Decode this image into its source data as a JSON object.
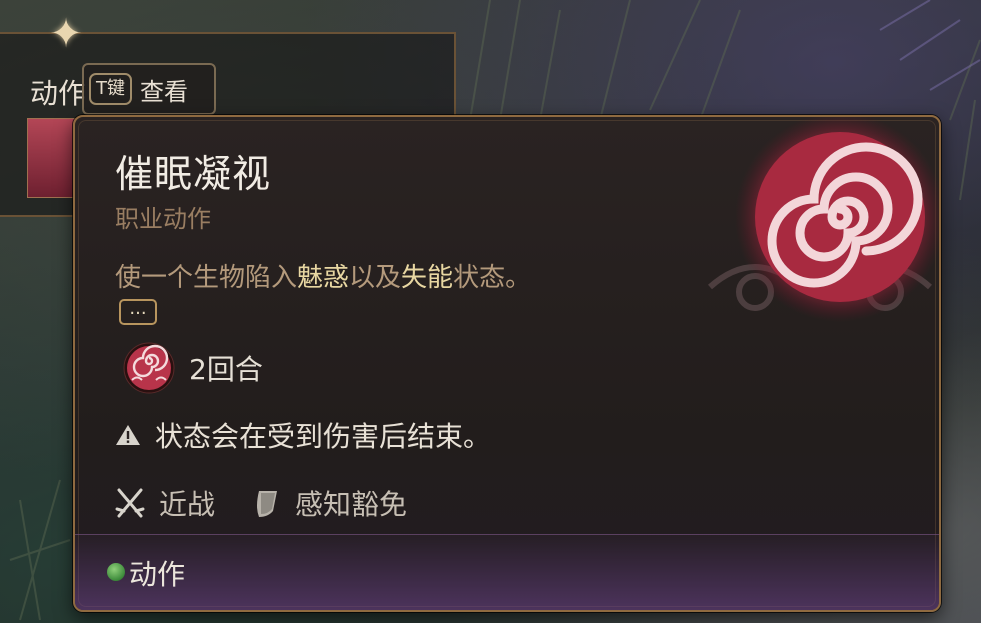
{
  "background_panel": {
    "title": "动作",
    "keyhint": {
      "key": "T键",
      "action": "查看"
    }
  },
  "tooltip": {
    "title": "催眠凝视",
    "subtitle": "职业动作",
    "description": {
      "part1": "使一个生物陷入",
      "highlight1": "魅惑",
      "part2": "以及",
      "highlight2": "失能",
      "part3": "状态。"
    },
    "more_label": "...",
    "duration": "2回合",
    "warning": "状态会在受到伤害后结束。",
    "tags": [
      {
        "icon": "crossed-swords-icon",
        "label": "近战"
      },
      {
        "icon": "shield-icon",
        "label": "感知豁免"
      }
    ],
    "footer": {
      "resource_label": "动作",
      "resource_color": "#4c9a43"
    }
  },
  "colors": {
    "accent_border": "#8f6a40",
    "title": "#f1ece4",
    "subtitle": "#9a7e62",
    "description": "#b49a7c",
    "highlight": "#e8d7a2",
    "spell_red": "#c23a50"
  },
  "icons": {
    "star": "compass-star-icon",
    "spell": "hypnotic-spiral-icon",
    "warning": "warning-triangle-icon"
  }
}
